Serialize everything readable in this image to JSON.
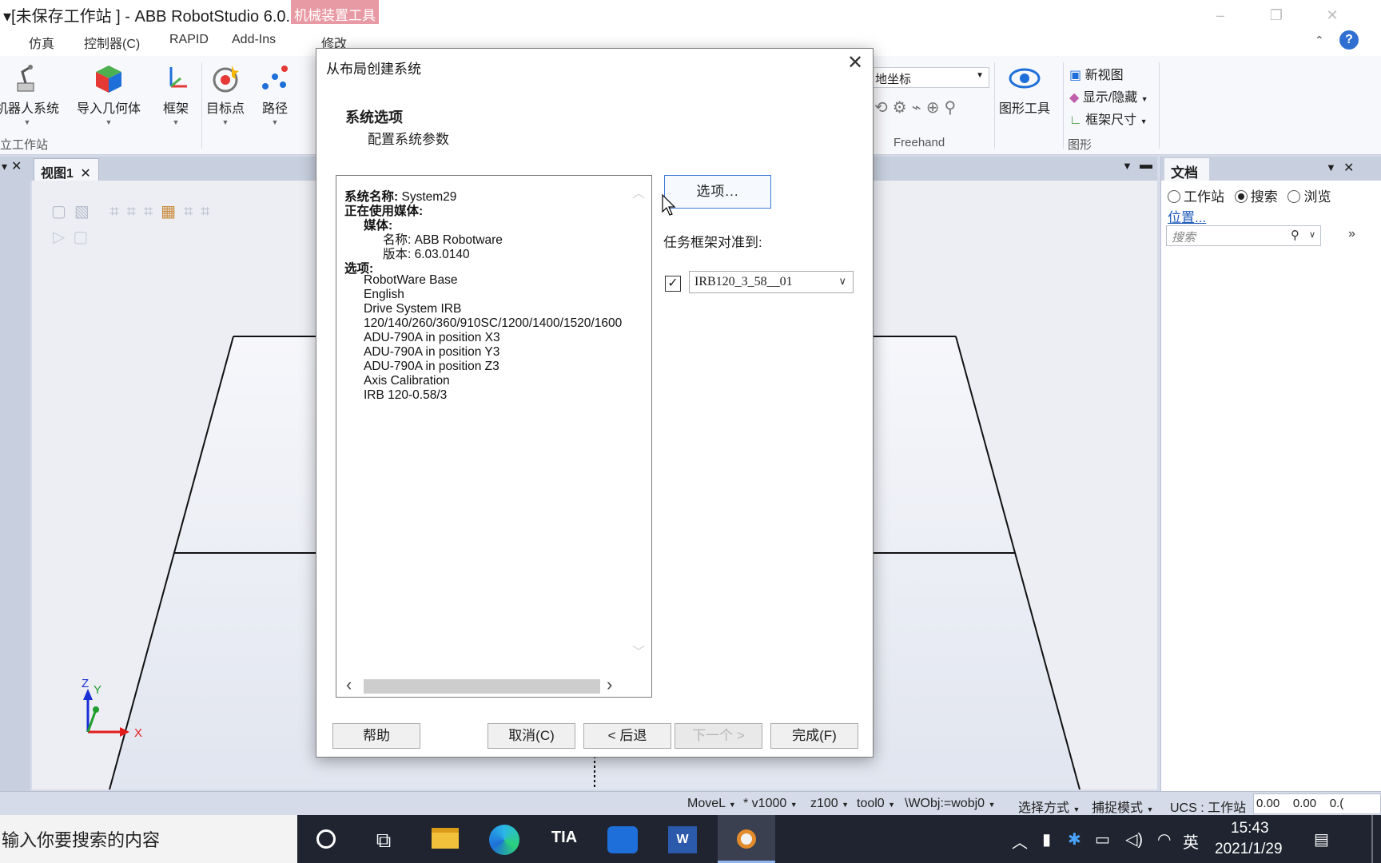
{
  "app": {
    "title": "[未保存工作站 ] - ABB RobotStudio 6.0...",
    "context_tab": "机械装置工具",
    "window_controls": {
      "minimize": "–",
      "restore": "❐",
      "close": "✕"
    }
  },
  "menu": {
    "items": [
      "仿真",
      "控制器(C)",
      "RAPID",
      "Add-Ins",
      "修改"
    ],
    "help": "?"
  },
  "ribbon": {
    "buttons": [
      {
        "label": "机器人系统",
        "icon": "robot-icon"
      },
      {
        "label": "导入几何体",
        "icon": "cube-icon"
      },
      {
        "label": "框架",
        "icon": "frame-icon"
      },
      {
        "label": "目标点",
        "icon": "target-icon"
      },
      {
        "label": "路径",
        "icon": "path-icon"
      }
    ],
    "group_left": "立工作站",
    "coord_select": "地坐标",
    "freehand_label": "Freehand",
    "graphics_tools": "图形工具",
    "new_view": "新视图",
    "show_hide": "显示/隐藏",
    "frame_size": "框架尺寸",
    "group_graphics": "图形"
  },
  "view": {
    "tab_label": "视图1",
    "axis": {
      "x": "X",
      "y": "Y",
      "z": "Z"
    }
  },
  "right_panel": {
    "tab_label": "文档",
    "radio_station": "工作站",
    "radio_search": "搜索",
    "radio_browse": "浏览",
    "location_link": "位置...",
    "search_placeholder": "搜索"
  },
  "dialog": {
    "title": "从布局创建系统",
    "heading": "系统选项",
    "subheading": "配置系统参数",
    "info": {
      "system_name_label": "系统名称:",
      "system_name": "System29",
      "media_in_use_label": "正在使用媒体:",
      "media_label": "媒体:",
      "media_name": "名称: ABB Robotware",
      "media_version": "版本: 6.03.0140",
      "options_label": "选项:",
      "options": [
        "RobotWare Base",
        "English",
        "Drive System IRB",
        "120/140/260/360/910SC/1200/1400/1520/1600",
        "ADU-790A in position X3",
        "ADU-790A in position Y3",
        "ADU-790A in position Z3",
        "Axis Calibration",
        "IRB 120-0.58/3"
      ]
    },
    "options_button": "选项...",
    "task_frame_label": "任务框架对准到:",
    "task_frame_checked": true,
    "task_frame_value": "IRB120_3_58__01",
    "buttons": {
      "help": "帮助",
      "cancel": "取消(C)",
      "back": "< 后退",
      "next": "下一个 >",
      "finish": "完成(F)"
    }
  },
  "status_bar": {
    "instruction": "MoveL",
    "speed": "* v1000",
    "zone": "z100",
    "tool": "tool0",
    "wobj": "\\WObj:=wobj0",
    "select_mode": "选择方式",
    "snap_mode": "捕捉模式",
    "ucs": "UCS : 工作站",
    "coord_x": "0.00",
    "coord_y": "0.00",
    "coord_z": "0.("
  },
  "taskbar": {
    "search_text": "输入你要搜索的内容",
    "tray_lang": "英",
    "time": "15:43",
    "date": "2021/1/29"
  }
}
